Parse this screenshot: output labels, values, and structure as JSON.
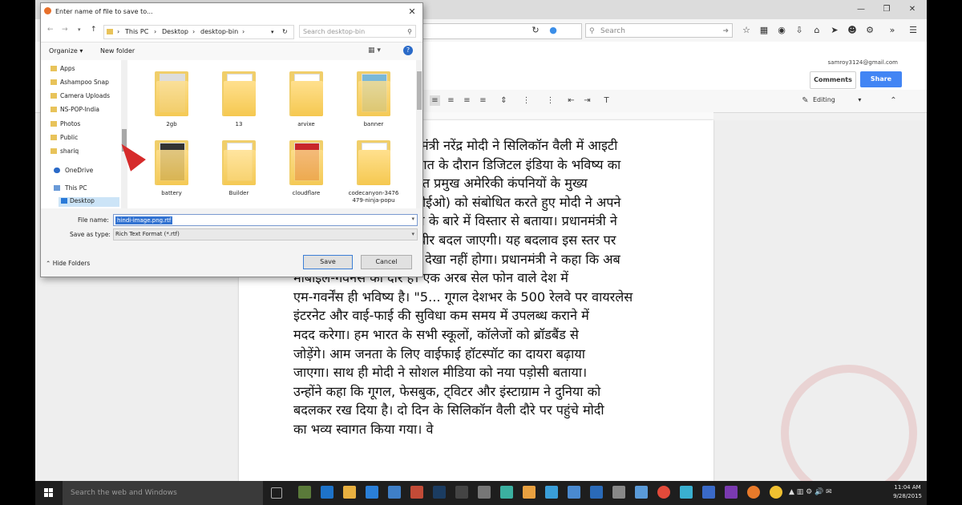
{
  "colors": {
    "share": "#4285f4",
    "dialog_sel": "#3373d1",
    "taskbar": "#1e1e1e",
    "folder": "#f0ce6a"
  },
  "browser": {
    "search_placeholder": "Search",
    "account": "samroy3124@gmail.com",
    "comments_label": "Comments",
    "share_label": "Share",
    "editing_label": "Editing"
  },
  "document": {
    "lines": [
      "नमंत्री नरेंद्र मोदी ने सिलिकॉन वैली में आइटी",
      "कात के दौरान डिजिटल इंडिया के भविष्य का",
      "रात प्रमुख अमेरिकी कंपनियों के मुख्य",
      "सीईओ) को संबोधित करते हुए मोदी ने अपने",
      "या के बारे में विस्तार से बताया। प्रधानमंत्री ने",
      "स्वीर बदल जाएगी। यह बदलाव इस स्तर पर",
      "ने देखा नहीं होगा। प्रधानमंत्री ने कहा कि अब",
      "मोबाइल-गवर्नेंस का दौर है। एक अरब सेल फोन वाले देश में",
      "एम-गवर्नेंस ही भविष्य है। \"5... गूगल देशभर के 500 रेलवे पर वायरलेस",
      "इंटरनेट और वाई-फाई की सुविधा कम समय में उपलब्ध कराने में",
      "मदद करेगा। हम भारत के सभी स्कूलों, कॉलेजों को ब्रॉडबैंड से",
      "जोड़ेंगे। आम जनता के लिए वाईफाई हॉटस्पॉट का दायरा बढ़ाया",
      "जाएगा। साथ ही मोदी ने सोशल मीडिया को नया पड़ोसी बताया।",
      "उन्होंने कहा कि गूगल, फेसबुक, ट्विटर और इंस्टाग्राम ने दुनिया को",
      "बदलकर रख दिया है। दो दिन के सिलिकॉन वैली दौरे पर पहुंचे मोदी",
      "का भव्य स्वागत किया गया। वे"
    ]
  },
  "dialog": {
    "title": "Enter name of file to save to...",
    "breadcrumb": [
      "This PC",
      "Desktop",
      "desktop-bin"
    ],
    "search_placeholder": "Search desktop-bin",
    "organize": "Organize ▾",
    "new_folder": "New folder",
    "nav_items": [
      "Apps",
      "Ashampoo Snap",
      "Camera Uploads",
      "NS-POP-India",
      "Photos",
      "Public",
      "shariq",
      "OneDrive",
      "This PC",
      "Desktop"
    ],
    "files": [
      {
        "name": "2gb"
      },
      {
        "name": "13"
      },
      {
        "name": "arvixe"
      },
      {
        "name": "banner"
      },
      {
        "name": "battery"
      },
      {
        "name": "Builder"
      },
      {
        "name": "cloudflare"
      },
      {
        "name": "codecanyon-3476479-ninja-popu"
      }
    ],
    "file_name_label": "File name:",
    "file_name_value": "hindi-image.png.rtf",
    "save_as_label": "Save as type:",
    "save_as_value": "Rich Text Format (*.rtf)",
    "hide_folders": "Hide Folders",
    "save": "Save",
    "cancel": "Cancel"
  },
  "taskbar": {
    "search_placeholder": "Search the web and Windows",
    "time": "11:04 AM",
    "date": "9/28/2015"
  }
}
